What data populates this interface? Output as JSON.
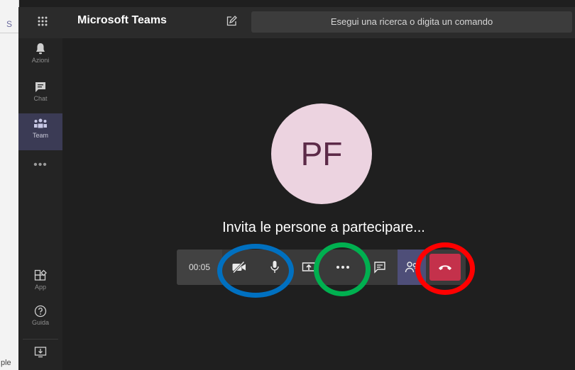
{
  "browser": {
    "tab_char": "S",
    "bottom_text": "ple"
  },
  "header": {
    "title": "Microsoft Teams",
    "search_placeholder": "Esegui una ricerca o digita un comando",
    "grid_icon": "app-launcher-icon",
    "compose_icon": "new-chat-icon"
  },
  "rail": {
    "items": [
      {
        "label": "Azioni",
        "icon": "bell-icon"
      },
      {
        "label": "Chat",
        "icon": "chat-icon"
      },
      {
        "label": "Team",
        "icon": "teams-icon",
        "active": true
      },
      {
        "label": "App",
        "icon": "apps-icon"
      },
      {
        "label": "Guida",
        "icon": "help-icon"
      }
    ],
    "more": "•••"
  },
  "call": {
    "avatar_initials": "PF",
    "invite_text": "Invita le persone a partecipare...",
    "timer": "00:05"
  },
  "colors": {
    "accent": "#4e4e78",
    "hangup": "#c4314b",
    "ring_blue": "#0070c0",
    "ring_green": "#00b050",
    "ring_red": "#ff0000"
  }
}
